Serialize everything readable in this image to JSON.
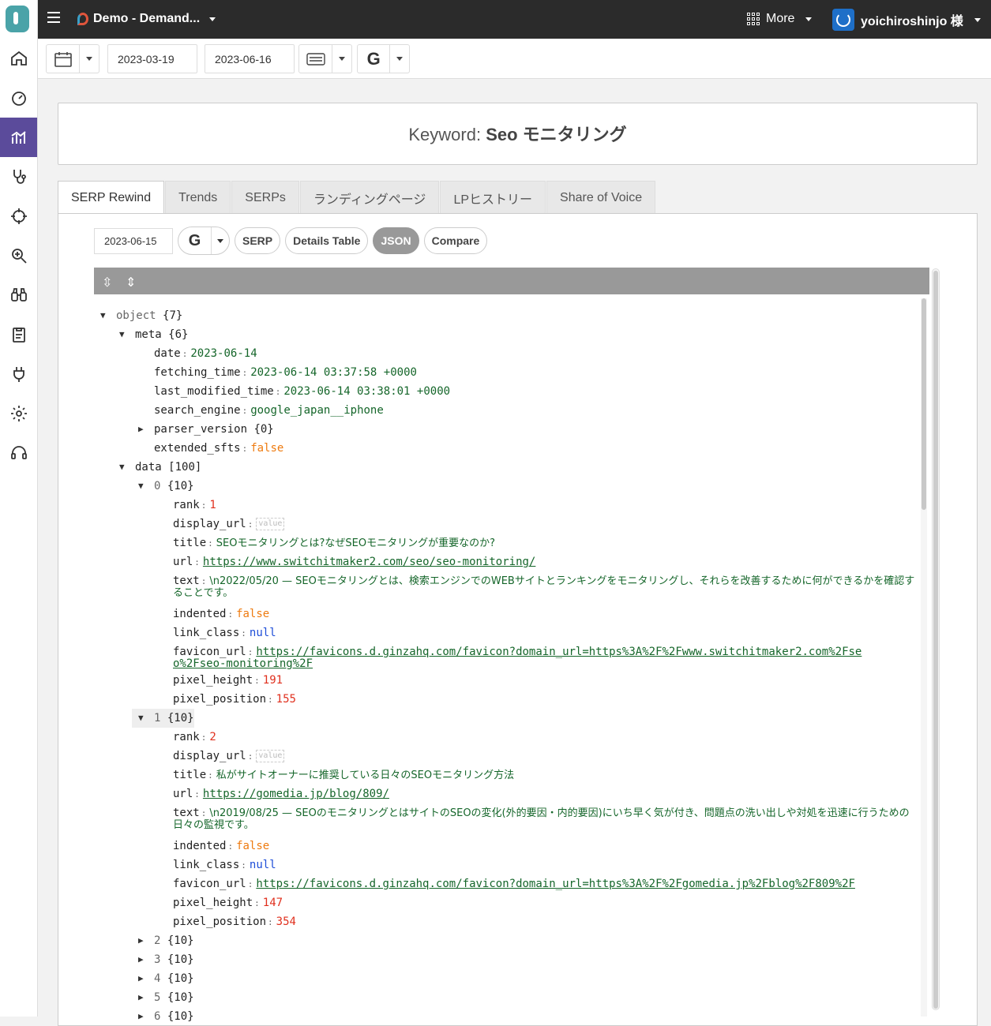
{
  "topbar": {
    "project": "Demo - Demand...",
    "more": "More",
    "user": "yoichiroshinjo 様"
  },
  "toolbar": {
    "start_date": "2023-03-19",
    "end_date": "2023-06-16"
  },
  "keyword": {
    "prefix": "Keyword:",
    "value": "Seo モニタリング"
  },
  "tabs": [
    "SERP Rewind",
    "Trends",
    "SERPs",
    "ランディングページ",
    "LPヒストリー",
    "Share of Voice"
  ],
  "subbar": {
    "date": "2023-06-15",
    "buttons": [
      "SERP",
      "Details Table",
      "JSON",
      "Compare"
    ]
  },
  "json_tree": {
    "root": {
      "key": "object",
      "count": "{7}"
    },
    "meta": {
      "key": "meta",
      "count": "{6}"
    },
    "meta_date": {
      "key": "date",
      "value": "2023-06-14"
    },
    "meta_fetching_time": {
      "key": "fetching_time",
      "value": "2023-06-14 03:37:58 +0000"
    },
    "meta_last_modified_time": {
      "key": "last_modified_time",
      "value": "2023-06-14 03:38:01 +0000"
    },
    "meta_search_engine": {
      "key": "search_engine",
      "value": "google_japan__iphone"
    },
    "meta_parser_version": {
      "key": "parser_version",
      "count": "{0}"
    },
    "meta_extended_sfts": {
      "key": "extended_sfts",
      "value": "false"
    },
    "data": {
      "key": "data",
      "count": "[100]"
    },
    "item0": {
      "index": "0",
      "count": "{10}",
      "rank": "1",
      "title": "SEOモニタリングとは?なぜSEOモニタリングが重要なのか?",
      "url": "https://www.switchitmaker2.com/seo/seo-monitoring/",
      "text": "\\n2022/05/20 — SEOモニタリングとは、検索エンジンでのWEBサイトとランキングをモニタリングし、それらを改善するために何ができるかを確認することです。",
      "indented": "false",
      "link_class": "null",
      "favicon_url": "https://favicons.d.ginzahq.com/favicon?domain_url=https%3A%2F%2Fwww.switchitmaker2.com%2Fseo%2Fseo-monitoring%2F",
      "pixel_height": "191",
      "pixel_position": "155"
    },
    "item1": {
      "index": "1",
      "count": "{10}",
      "rank": "2",
      "title": "私がサイトオーナーに推奨している日々のSEOモニタリング方法",
      "url": "https://gomedia.jp/blog/809/",
      "text": "\\n2019/08/25 — SEOのモニタリングとはサイトのSEOの変化(外的要因・内的要因)にいち早く気が付き、問題点の洗い出しや対処を迅速に行うための日々の監視です。",
      "indented": "false",
      "link_class": "null",
      "favicon_url": "https://favicons.d.ginzahq.com/favicon?domain_url=https%3A%2F%2Fgomedia.jp%2Fblog%2F809%2F",
      "pixel_height": "147",
      "pixel_position": "354"
    },
    "collapsed": [
      {
        "index": "2",
        "count": "{10}"
      },
      {
        "index": "3",
        "count": "{10}"
      },
      {
        "index": "4",
        "count": "{10}"
      },
      {
        "index": "5",
        "count": "{10}"
      },
      {
        "index": "6",
        "count": "{10}"
      }
    ],
    "field_names": {
      "rank": "rank",
      "display_url": "display_url",
      "title": "title",
      "url": "url",
      "text": "text",
      "indented": "indented",
      "link_class": "link_class",
      "favicon_url": "favicon_url",
      "pixel_height": "pixel_height",
      "pixel_position": "pixel_position"
    },
    "value_placeholder": "value"
  },
  "icons": [
    "menu-icon",
    "calendar-icon",
    "google-icon",
    "grid-icon",
    "power-icon"
  ],
  "colors": {
    "accent": "#5b4b9b",
    "topbar": "#2b2b2b",
    "string": "#15662a",
    "number": "#e0301e",
    "boolean": "#ee7b10",
    "null": "#1e4ed8"
  }
}
